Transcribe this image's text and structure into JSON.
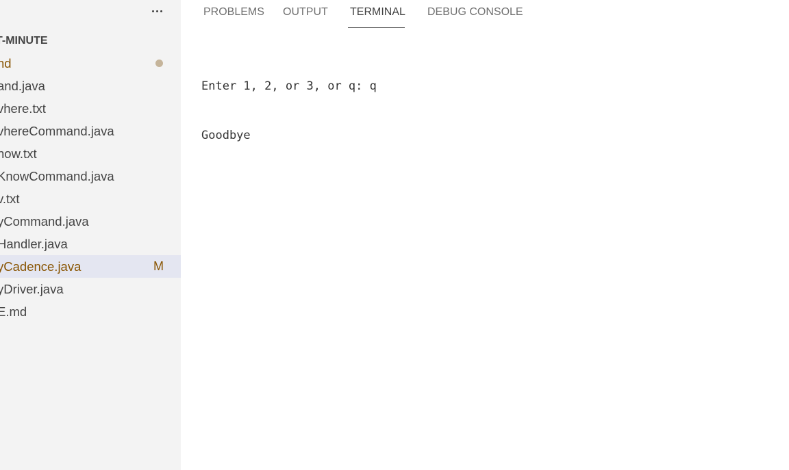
{
  "sidebar": {
    "more_actions_icon": "ellipsis-icon",
    "section_title": "T-MINUTE",
    "files": [
      {
        "label": "nd",
        "status": "dot"
      },
      {
        "label": "and.java",
        "status": ""
      },
      {
        "label": "vhere.txt",
        "status": ""
      },
      {
        "label": "vhereCommand.java",
        "status": ""
      },
      {
        "label": "now.txt",
        "status": ""
      },
      {
        "label": "KnowCommand.java",
        "status": ""
      },
      {
        "label": "v.txt",
        "status": ""
      },
      {
        "label": "yCommand.java",
        "status": ""
      },
      {
        "label": "Handler.java",
        "status": ""
      },
      {
        "label": "yCadence.java",
        "status": "M"
      },
      {
        "label": "yDriver.java",
        "status": ""
      },
      {
        "label": "E.md",
        "status": ""
      }
    ]
  },
  "panel": {
    "tabs": [
      {
        "label": "PROBLEMS"
      },
      {
        "label": "OUTPUT"
      },
      {
        "label": "TERMINAL"
      },
      {
        "label": "DEBUG CONSOLE"
      }
    ],
    "active_tab": "TERMINAL",
    "terminal_lines": [
      "Enter 1, 2, or 3, or q: q",
      "Goodbye"
    ]
  },
  "colors": {
    "sidebar_bg": "#f3f3f3",
    "selected_row_bg": "#e4e6f1",
    "modified_text": "#895503",
    "dot": "#c5b49a"
  }
}
